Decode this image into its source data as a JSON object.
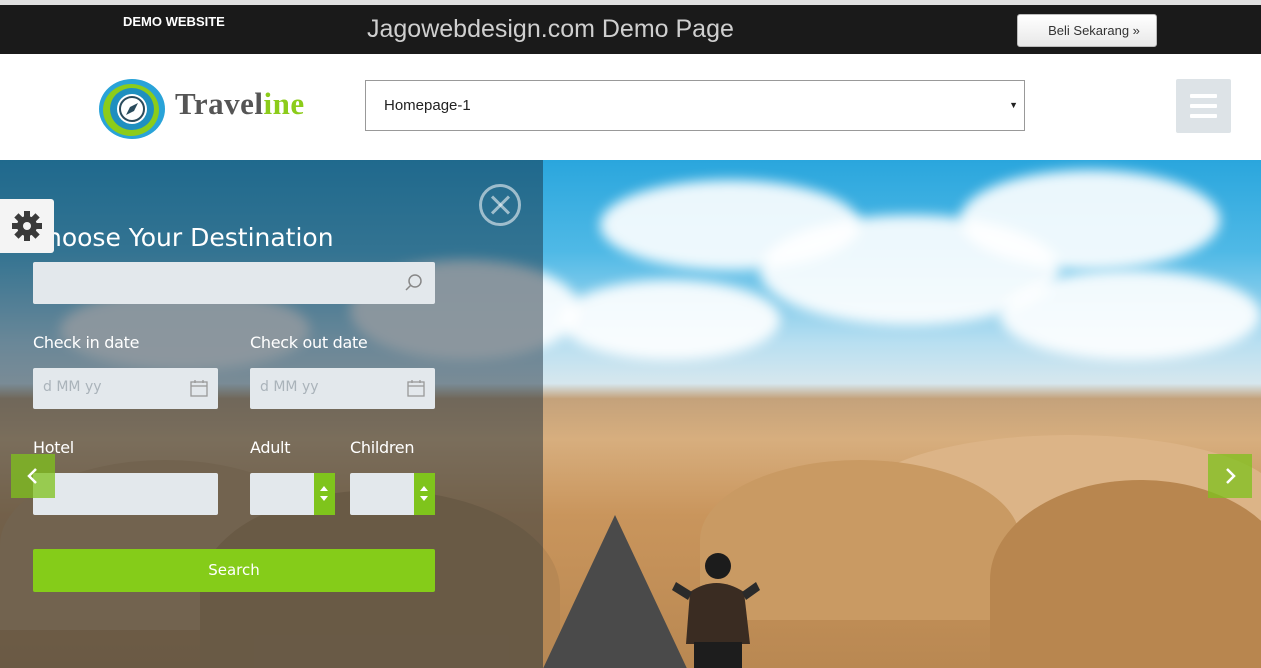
{
  "demo_bar": {
    "label": "DEMO WEBSITE",
    "title": "Jagowebdesign.com Demo Page",
    "buy_button": "Beli Sekarang »"
  },
  "header": {
    "brand_dark": "Travel",
    "brand_accent": "ine",
    "page_select_value": "Homepage-1",
    "menu_icon": "hamburger-icon"
  },
  "booking_form": {
    "title": "hoose Your Destination",
    "search_icon": "search-icon",
    "check_in_label": "Check in date",
    "check_in_placeholder": "d MM yy",
    "check_out_label": "Check out date",
    "check_out_placeholder": "d MM yy",
    "hotel_label": "Hotel",
    "adult_label": "Adult",
    "children_label": "Children",
    "search_button": "Search"
  },
  "colors": {
    "accent": "#85cc19",
    "demo_bar_bg": "#1a1a1a",
    "field_bg": "#e3e8ec"
  }
}
